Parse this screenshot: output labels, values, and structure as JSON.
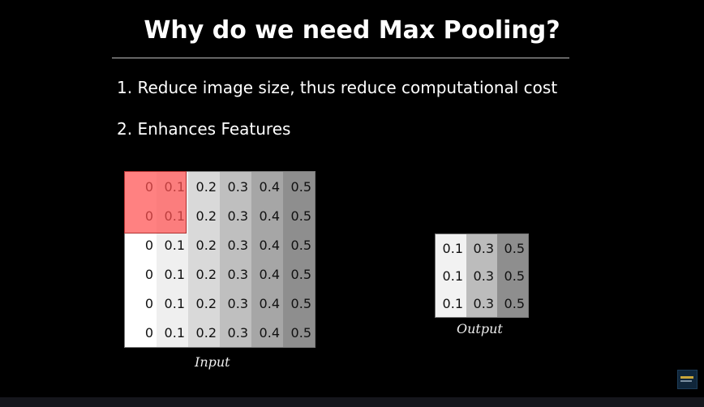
{
  "slide": {
    "title": "Why do we need Max Pooling?",
    "points": [
      "1. Reduce image size, thus reduce computational cost",
      "2. Enhances Features"
    ],
    "input_label": "Input",
    "output_label": "Output",
    "input_grid": [
      [
        "0",
        "0.1",
        "0.2",
        "0.3",
        "0.4",
        "0.5"
      ],
      [
        "0",
        "0.1",
        "0.2",
        "0.3",
        "0.4",
        "0.5"
      ],
      [
        "0",
        "0.1",
        "0.2",
        "0.3",
        "0.4",
        "0.5"
      ],
      [
        "0",
        "0.1",
        "0.2",
        "0.3",
        "0.4",
        "0.5"
      ],
      [
        "0",
        "0.1",
        "0.2",
        "0.3",
        "0.4",
        "0.5"
      ],
      [
        "0",
        "0.1",
        "0.2",
        "0.3",
        "0.4",
        "0.5"
      ]
    ],
    "output_grid": [
      [
        "0.1",
        "0.3",
        "0.5"
      ],
      [
        "0.1",
        "0.3",
        "0.5"
      ],
      [
        "0.1",
        "0.3",
        "0.5"
      ]
    ],
    "input_column_colors": [
      "#ffffff",
      "#efefef",
      "#d9d9d9",
      "#bfbfbf",
      "#a6a6a6",
      "#8e8e8e"
    ],
    "output_column_colors": [
      "#f2f2f2",
      "#bcbcbc",
      "#8e8e8e"
    ],
    "highlight_color": "#ff5050"
  }
}
